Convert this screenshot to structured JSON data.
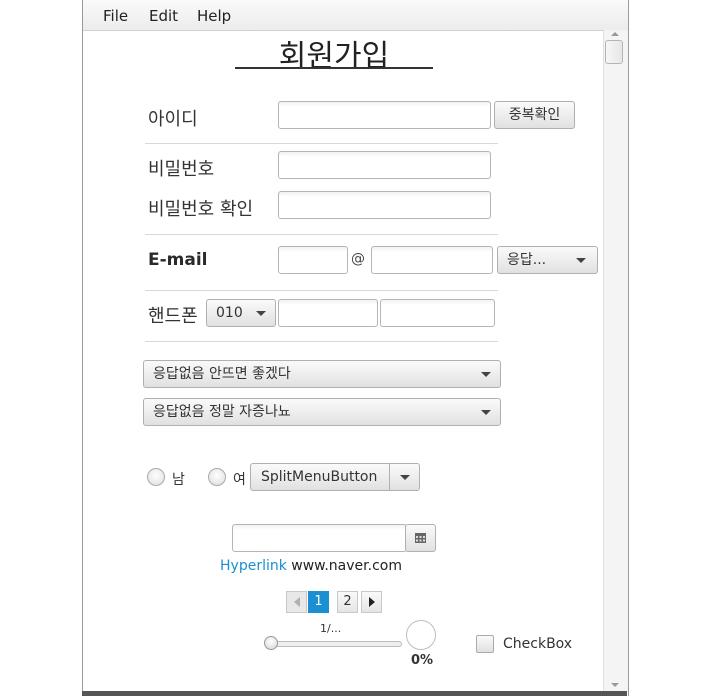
{
  "menu": {
    "file": "File",
    "edit": "Edit",
    "help": "Help"
  },
  "form": {
    "title": "회원가입",
    "id_label": "아이디",
    "dup_check_button": "중복확인",
    "password_label": "비밀번호",
    "password_confirm_label": "비밀번호 확인",
    "email_label": "E-mail",
    "email_at": "@",
    "email_domain_combo": "응답...",
    "phone_label": "핸드폰",
    "phone_prefix_combo": "010",
    "combo1": "응답없음 안뜨면 좋겠다",
    "combo2": "응답없음 정말 자증나뇨",
    "radio_male": "남",
    "radio_female": "여",
    "split_menu_button": "SplitMenuButton",
    "hyperlink": "Hyperlink",
    "hyperlink_text": "www.naver.com",
    "pagination": {
      "pages": [
        "1",
        "2"
      ],
      "current": "1"
    },
    "slider_label": "1/...",
    "slider_value": 0,
    "progress_label": "0%",
    "progress_value": 0,
    "checkbox_label": "CheckBox"
  }
}
